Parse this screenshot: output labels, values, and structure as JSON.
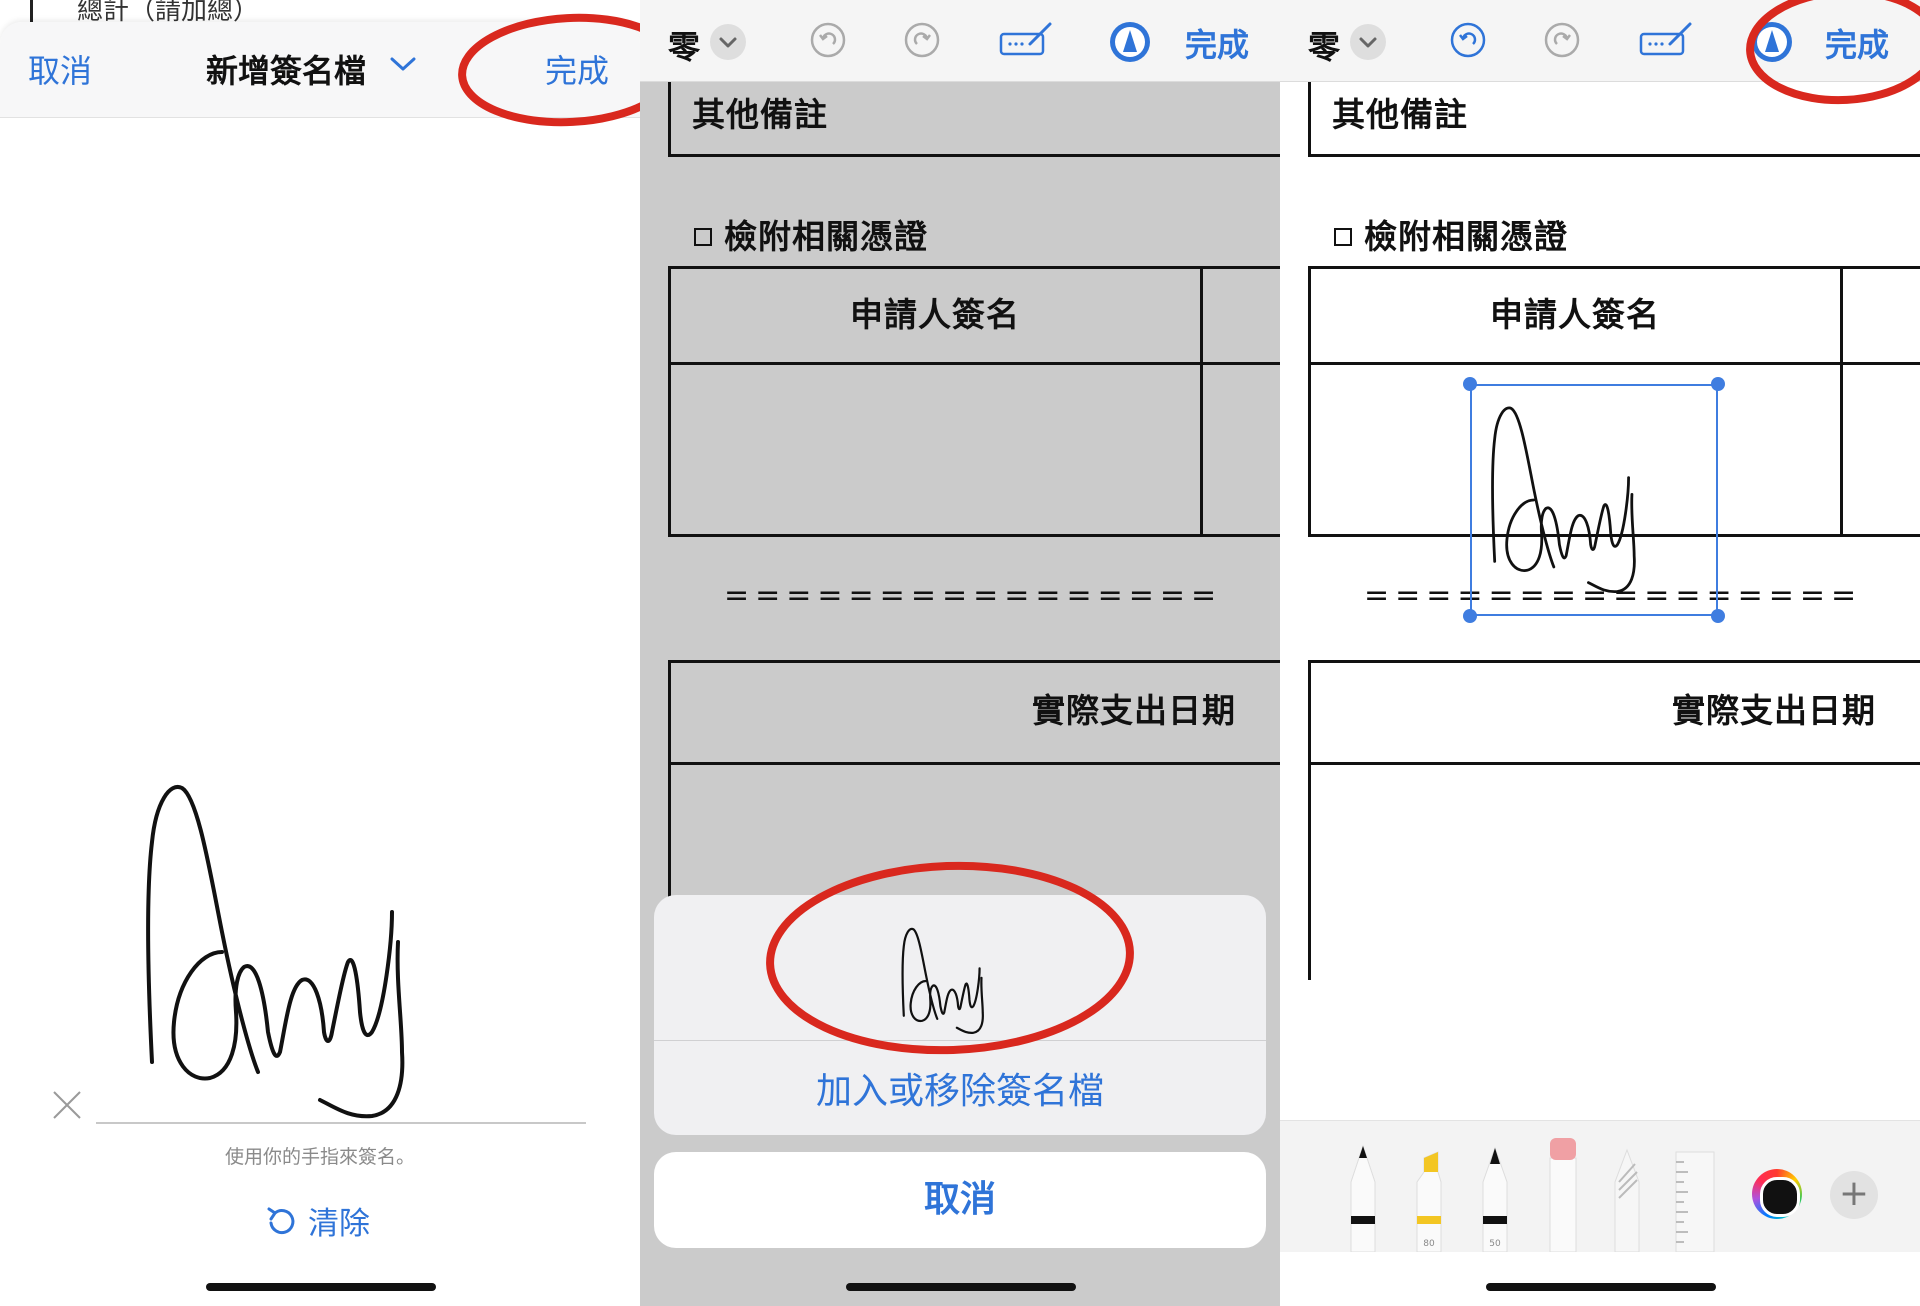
{
  "panel1": {
    "peek_text": "總計（請加總）",
    "header": {
      "cancel": "取消",
      "title": "新增簽名檔",
      "done": "完成"
    },
    "hint": "使用你的手指來簽名。",
    "clear": "清除"
  },
  "toolbar": {
    "font_label": "零",
    "done": "完成"
  },
  "document": {
    "other_notes": "其他備註",
    "attach_receipts": "檢附相關憑證",
    "applicant_signature": "申請人簽名",
    "divider": "================",
    "actual_date": "實際支出日期"
  },
  "panel2": {
    "popup": {
      "add_remove": "加入或移除簽名檔",
      "cancel": "取消"
    }
  },
  "panel3": {
    "tools": {
      "pen_width_1": "80",
      "pen_width_2": "50"
    }
  },
  "colors": {
    "accent": "#2f74d8",
    "annotation": "#d9281e",
    "selection": "#3f7de0"
  }
}
